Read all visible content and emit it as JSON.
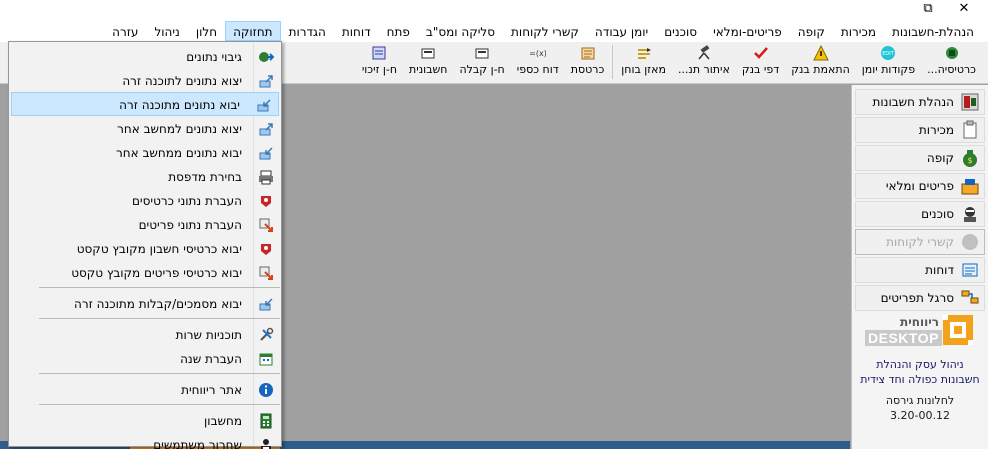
{
  "window": {
    "minimize_icon": "minimize-icon",
    "close_glyph": "✕",
    "restore_glyph": "⧉"
  },
  "menubar": {
    "items": [
      {
        "label": "הנהלת-חשבונות"
      },
      {
        "label": "מכירות"
      },
      {
        "label": "קופה"
      },
      {
        "label": "פריטים-ומלאי"
      },
      {
        "label": "סוכנים"
      },
      {
        "label": "יומן עבודה"
      },
      {
        "label": "קשרי לקוחות"
      },
      {
        "label": "סליקה ומס\"ב"
      },
      {
        "label": "פתח"
      },
      {
        "label": "דוחות"
      },
      {
        "label": "הגדרות"
      },
      {
        "label": "תחזוקה"
      },
      {
        "label": "חלון"
      },
      {
        "label": "ניהול"
      },
      {
        "label": "עזרה"
      }
    ],
    "active_index": 11
  },
  "toolbar": {
    "items": [
      {
        "label": "כרטיסיה...",
        "icon": "card-icon"
      },
      {
        "label": "פקודות יומן",
        "icon": "edit-icon"
      },
      {
        "label": "התאמת בנק",
        "icon": "warning-icon"
      },
      {
        "label": "דפי בנק",
        "icon": "checkmark-icon"
      },
      {
        "label": "איתור תנ...",
        "icon": "telescope-icon"
      },
      {
        "label": "מאזן בוחן",
        "icon": "balance-icon"
      },
      {
        "label": "כרטסת",
        "icon": "ledger-icon"
      },
      {
        "label": "דוח כספי",
        "icon": "formula-icon"
      },
      {
        "label": "ח-ן קבלה",
        "icon": "receipt-icon"
      },
      {
        "label": "חשבונית",
        "icon": "invoice-icon"
      },
      {
        "label": "ח-ן זיכוי",
        "icon": "credit-icon"
      }
    ]
  },
  "sidepanel": {
    "items": [
      {
        "label": "הנהלת חשבונות",
        "icon": "accounting-icon",
        "disabled": false
      },
      {
        "label": "מכירות",
        "icon": "clipboard-icon",
        "disabled": false
      },
      {
        "label": "קופה",
        "icon": "money-bag-icon",
        "disabled": false
      },
      {
        "label": "פריטים ומלאי",
        "icon": "inventory-icon",
        "disabled": false
      },
      {
        "label": "סוכנים",
        "icon": "agent-icon",
        "disabled": false
      },
      {
        "label": "קשרי לקוחות",
        "icon": "customers-icon",
        "disabled": true
      },
      {
        "label": "דוחות",
        "icon": "printer-report-icon",
        "disabled": false
      },
      {
        "label": "סרגל תפריטים",
        "icon": "menu-bar-icon",
        "disabled": false
      }
    ],
    "promo": {
      "logo_top": "ריווחית",
      "logo_bottom": "DESKTOP",
      "line1": "ניהול עסק והנהלת",
      "line2": "חשבונות כפולה וחד צידית",
      "version_label": "לחלונות גירסה",
      "version": "3.20-00.12"
    }
  },
  "dropdown": {
    "groups": [
      [
        {
          "label": "גיבוי נתונים",
          "icon": "backup-icon",
          "highlight": false
        },
        {
          "label": "יצוא נתונים לתוכנה זרה",
          "icon": "export-icon",
          "highlight": false
        },
        {
          "label": "יבוא נתונים מתוכנה זרה",
          "icon": "import-icon",
          "highlight": true
        },
        {
          "label": "יצוא נתונים למחשב אחר",
          "icon": "export-icon",
          "highlight": false
        },
        {
          "label": "יבוא נתונים ממחשב אחר",
          "icon": "import-icon",
          "highlight": false
        },
        {
          "label": "בחירת מדפסת",
          "icon": "printer-icon",
          "highlight": false
        },
        {
          "label": "העברת נתוני כרטיסים",
          "icon": "cards-transfer-icon",
          "highlight": false
        },
        {
          "label": "העברת נתוני פריטים",
          "icon": "items-transfer-icon",
          "highlight": false
        },
        {
          "label": "יבוא כרטיסי חשבון מקובץ טקסט",
          "icon": "cards-transfer-icon",
          "highlight": false
        },
        {
          "label": "יבוא כרטיסי פריטים מקובץ טקסט",
          "icon": "items-transfer-icon",
          "highlight": false
        }
      ],
      [
        {
          "label": "יבוא מסמכים/קבלות מתוכנה זרה",
          "icon": "import-icon",
          "highlight": false
        }
      ],
      [
        {
          "label": "תוכניות שרות",
          "icon": "tools-icon",
          "highlight": false
        },
        {
          "label": "העברת שנה",
          "icon": "calendar-icon",
          "highlight": false
        }
      ],
      [
        {
          "label": "אתר ריווחית",
          "icon": "info-icon",
          "highlight": false
        }
      ],
      [
        {
          "label": "מחשבון",
          "icon": "calculator-icon",
          "highlight": false
        },
        {
          "label": "שחרור משתמשים",
          "icon": "users-release-icon",
          "highlight": false
        }
      ]
    ]
  },
  "colors": {
    "highlight_bg": "#cce8ff",
    "highlight_border": "#99d1ff",
    "workspace": "#a0a0a0",
    "promo_orange": "#f2a31b"
  }
}
